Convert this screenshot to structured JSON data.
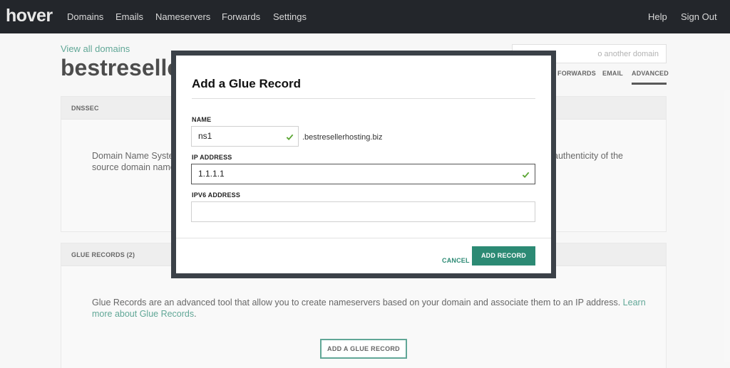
{
  "nav": {
    "logo": "hover",
    "items": [
      "Domains",
      "Emails",
      "Nameservers",
      "Forwards",
      "Settings"
    ],
    "help": "Help",
    "sign_out": "Sign Out"
  },
  "page": {
    "view_all": "View all domains",
    "domain_title": "bestreselle",
    "jump_placeholder": "o another domain",
    "tabs": [
      "FORWARDS",
      "EMAIL",
      "ADVANCED"
    ],
    "active_tab": "ADVANCED"
  },
  "dnssec": {
    "header": "DNSSEC",
    "line1": "Domain Name Syste",
    "line1_right": "authenticity of the",
    "line2": "source domain name"
  },
  "glue": {
    "header": "GLUE RECORDS (2)",
    "text1": "Glue Records are an advanced tool that allow you to create nameservers based on your domain and associate them to an IP address.",
    "link1": "Learn",
    "link2": "more about Glue Records",
    "text2_end": ".",
    "add_button": "ADD A GLUE RECORD"
  },
  "modal": {
    "title": "Add a Glue Record",
    "name_label": "NAME",
    "name_value": "ns1",
    "name_suffix": ".bestresellerhosting.biz",
    "ip_label": "IP ADDRESS",
    "ip_value": "1.1.1.1",
    "ipv6_label": "IPV6 ADDRESS",
    "ipv6_value": "",
    "cancel": "CANCEL",
    "submit": "ADD RECORD"
  },
  "colors": {
    "accent": "#2c8a74",
    "nav_bg": "#23262b",
    "modal_frame": "#3b4148",
    "valid_check": "#5aa532"
  }
}
